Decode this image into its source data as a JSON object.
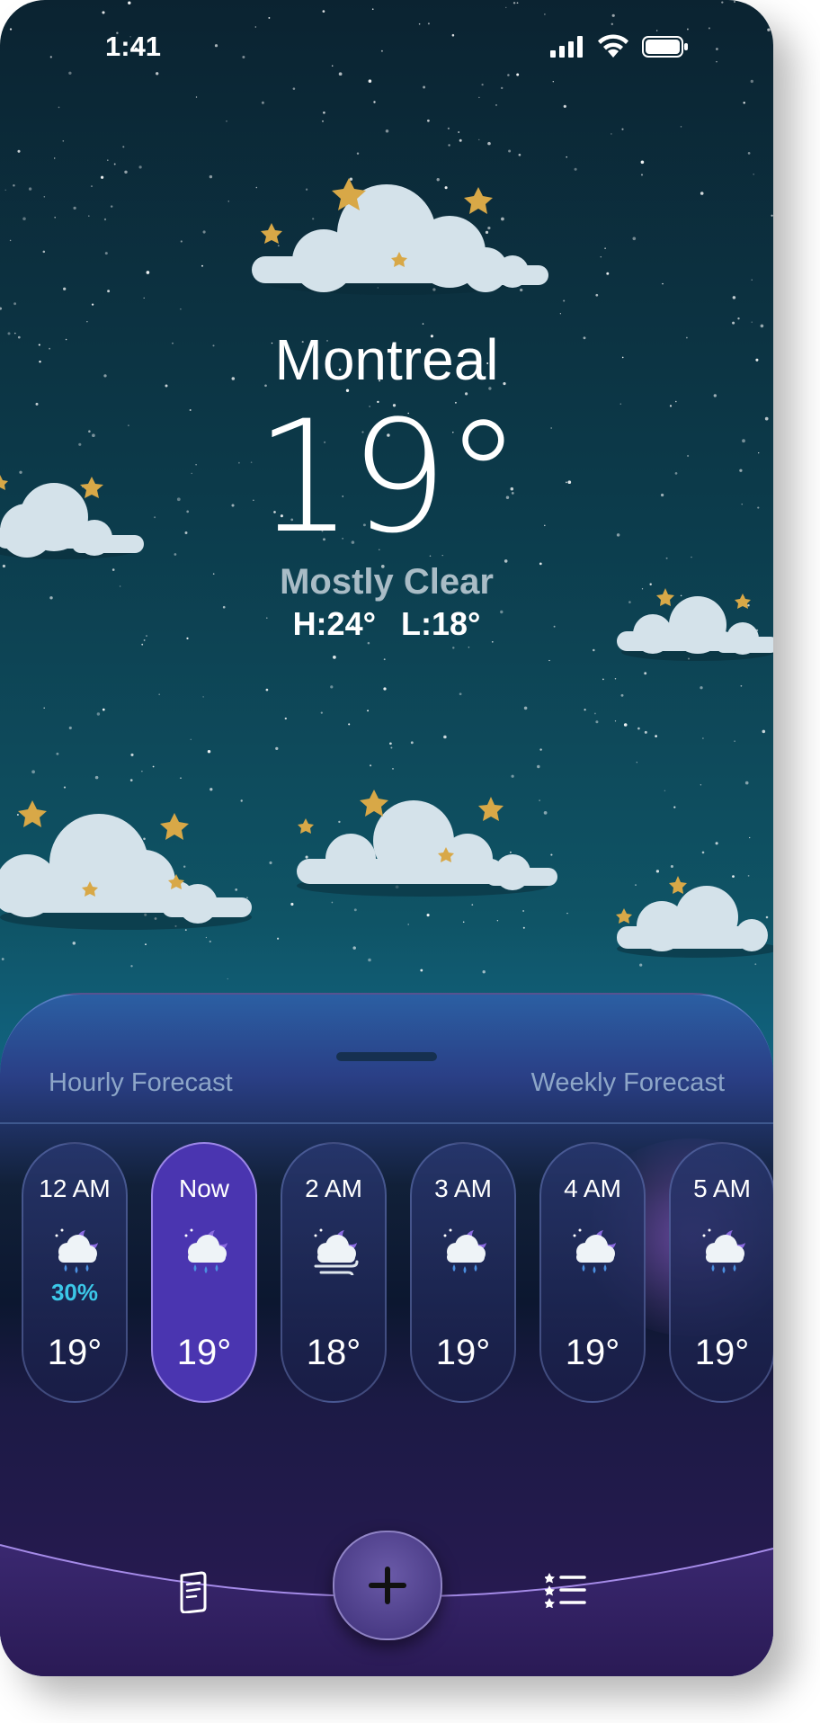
{
  "status_bar": {
    "time": "1:41"
  },
  "weather": {
    "city": "Montreal",
    "temperature": "19°",
    "condition": "Mostly Clear",
    "high_low": "H:24° L:18°"
  },
  "sheet": {
    "tabs": [
      "Hourly Forecast",
      "Weekly Forecast"
    ],
    "hourly": [
      {
        "time": "12 AM",
        "icon": "rain-cloud-moon-icon",
        "precip": "30%",
        "temp": "19°"
      },
      {
        "time": "Now",
        "icon": "rain-cloud-moon-icon",
        "precip": "",
        "temp": "19°",
        "active": true
      },
      {
        "time": "2 AM",
        "icon": "windy-cloud-moon-icon",
        "precip": "",
        "temp": "18°"
      },
      {
        "time": "3 AM",
        "icon": "rain-cloud-moon-icon",
        "precip": "",
        "temp": "19°"
      },
      {
        "time": "4 AM",
        "icon": "rain-cloud-moon-icon",
        "precip": "",
        "temp": "19°"
      },
      {
        "time": "5 AM",
        "icon": "rain-cloud-moon-icon",
        "precip": "",
        "temp": "19°"
      }
    ]
  },
  "tab_bar": {
    "items": [
      "map-icon",
      "add-icon",
      "list-icon"
    ]
  },
  "colors": {
    "accent": "#4a35b0",
    "precip": "#3bc7e7"
  }
}
